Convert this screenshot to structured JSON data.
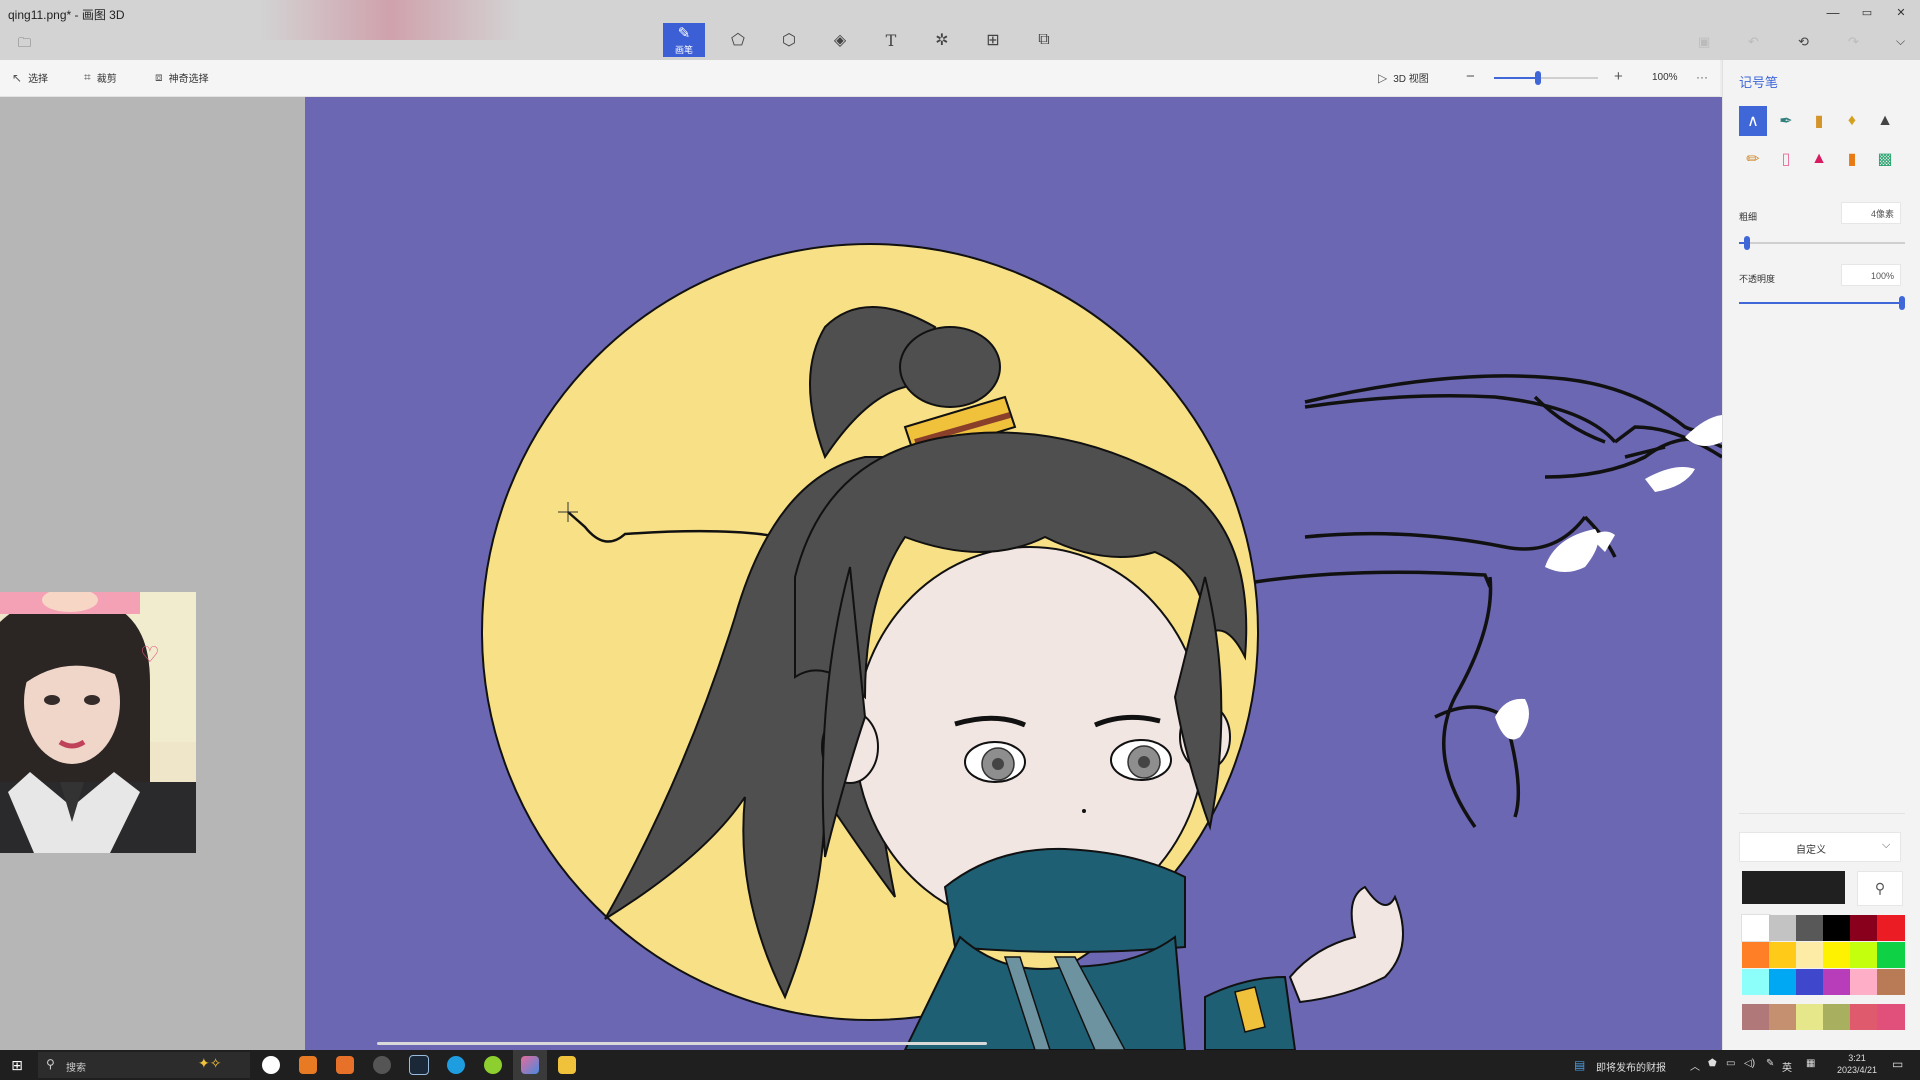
{
  "window": {
    "title": "qing11.png* - 画图 3D",
    "controls": {
      "minimize": "—",
      "maximize": "▭",
      "close": "✕"
    }
  },
  "modes": [
    {
      "name": "brushes",
      "label": "画笔",
      "icon": "brush-icon",
      "active": true
    },
    {
      "name": "2d-shapes",
      "icon": "shapes-2d-icon"
    },
    {
      "name": "3d-shapes",
      "icon": "cube-icon"
    },
    {
      "name": "stickers",
      "icon": "sticker-icon"
    },
    {
      "name": "text",
      "icon": "text-icon"
    },
    {
      "name": "effects",
      "icon": "effects-icon"
    },
    {
      "name": "canvas",
      "icon": "canvas-icon"
    },
    {
      "name": "3d-library",
      "icon": "library-icon"
    }
  ],
  "toolbar": {
    "select_label": "选择",
    "crop_label": "裁剪",
    "magic_select_label": "神奇选择",
    "view3d_label": "3D 视图",
    "zoom_value": 0.42,
    "zoom_text": "100%",
    "more": "···"
  },
  "panel": {
    "title": "记号笔",
    "thickness_label": "粗细",
    "thickness_value": "4像素",
    "thickness_level": 0.05,
    "opacity_label": "不透明度",
    "opacity_value": "100%",
    "opacity_level": 1.0,
    "color_mode": "自定义",
    "current_color": "#202020",
    "palette": [
      "#ffffff",
      "#c3c3c3",
      "#585858",
      "#000000",
      "#88001b",
      "#ec1c24",
      "#ff7f27",
      "#ffca18",
      "#fdeca6",
      "#fff200",
      "#c4ff0e",
      "#0ed145",
      "#8cfffb",
      "#00a8f3",
      "#3f48cc",
      "#b83dba",
      "#ffaec8",
      "#b97a56",
      "#b07878",
      "#c49070",
      "#e6e68a",
      "#a8b060",
      "#e05a6e",
      "#e0507a"
    ],
    "brushes": [
      "marker-icon",
      "calligraphy-pen-icon",
      "oil-brush-icon",
      "watercolor-icon",
      "pixel-pen-icon",
      "pencil-icon",
      "eraser-icon",
      "crayon-icon",
      "spray-can-icon",
      "fill-icon"
    ]
  },
  "taskbar": {
    "search_placeholder": "搜索",
    "news_label": "即将发布的财报",
    "ime_label": "英",
    "time": "3:21",
    "date": "2023/4/21"
  }
}
